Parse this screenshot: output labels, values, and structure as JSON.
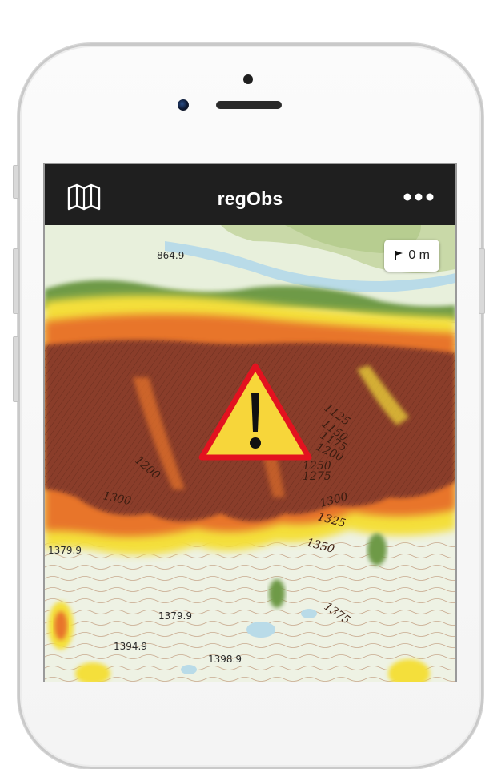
{
  "app": {
    "title": "regObs",
    "menu_icon": "map-icon",
    "more_icon": "more-horizontal-icon"
  },
  "map": {
    "scale_label": "0 m",
    "scale_icon": "flag-icon",
    "warning_icon": "warning-triangle-icon",
    "spot_heights": [
      "864.9",
      "1379.9",
      "1379.9",
      "1394.9",
      "1398.9"
    ],
    "contour_labels": [
      "1125",
      "1150",
      "1175",
      "1200",
      "1250",
      "1275",
      "1200",
      "1300",
      "1300",
      "1325",
      "1350",
      "1375"
    ]
  },
  "colors": {
    "topbar": "#1f1f1f",
    "warning_fill": "#f7d63a",
    "warning_border": "#e3121f",
    "steep_dark": "#8a3e2c",
    "steep_orange": "#e8752a",
    "steep_yellow": "#f4df3a",
    "forest_green": "#6e9a46",
    "water": "#b9dbe8"
  }
}
